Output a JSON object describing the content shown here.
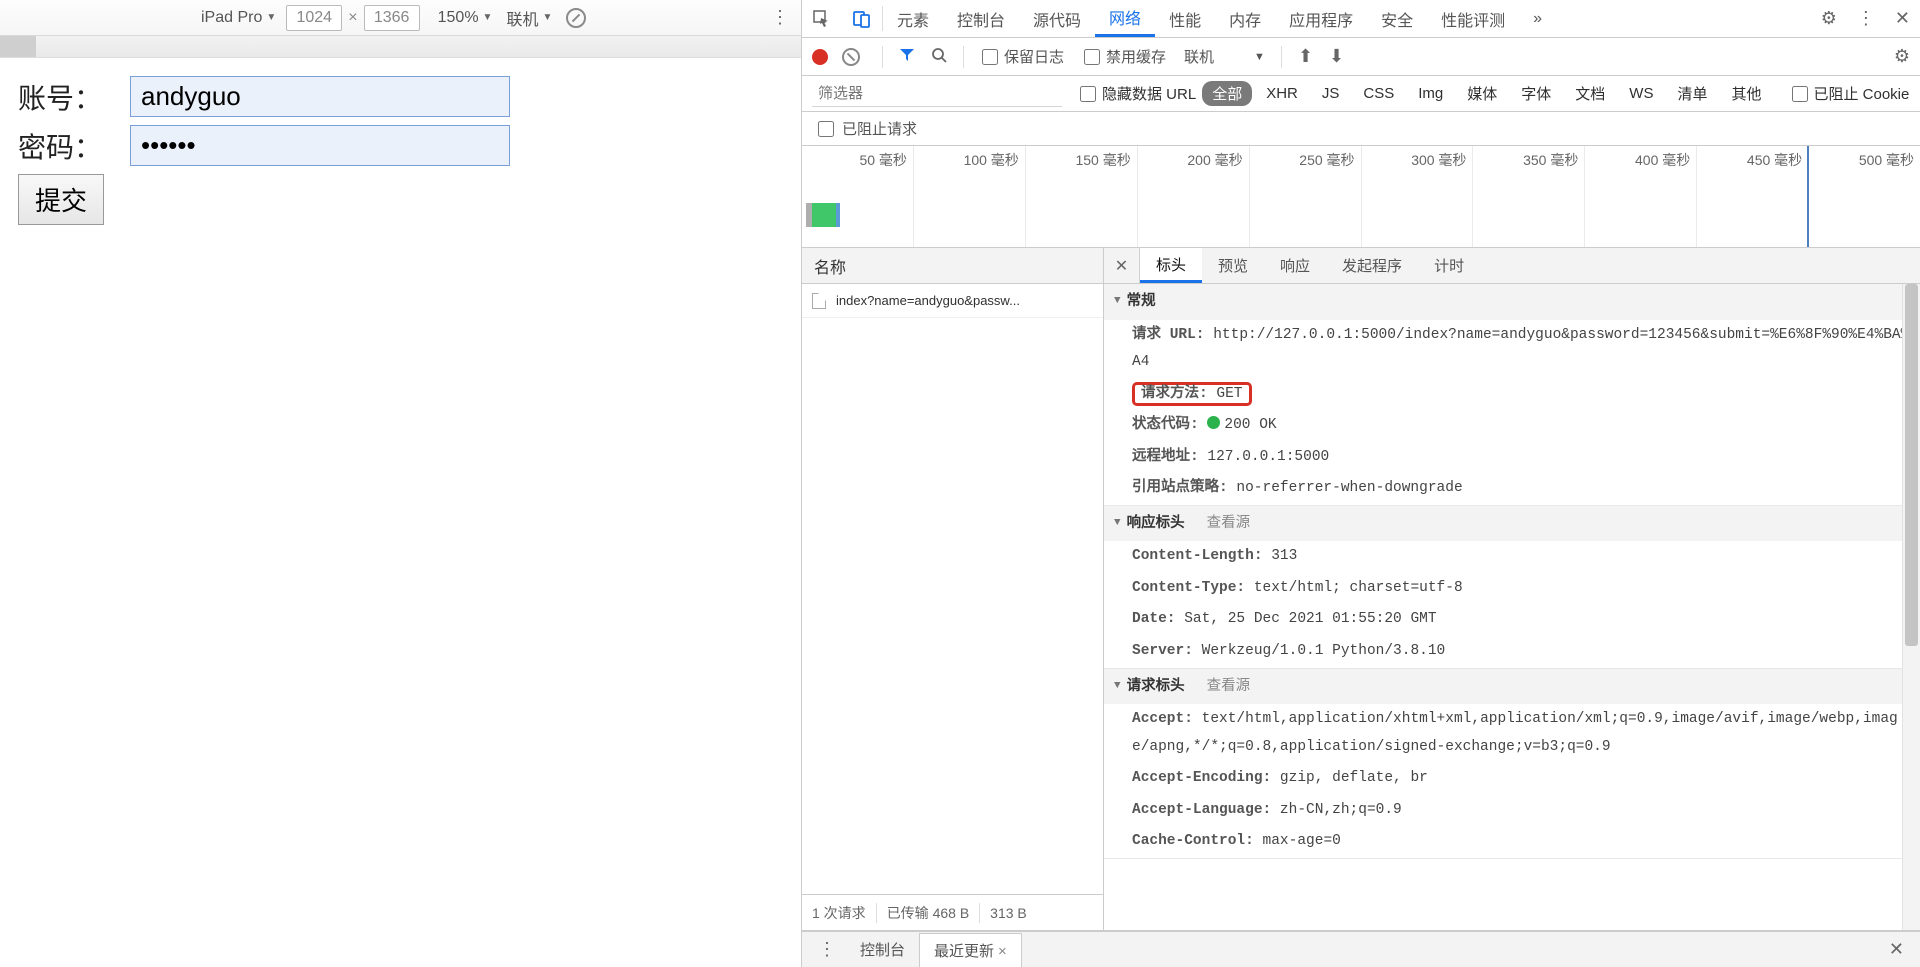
{
  "device_toolbar": {
    "device": "iPad Pro",
    "width": "1024",
    "height": "1366",
    "zoom": "150%",
    "status": "联机"
  },
  "form": {
    "account_label": "账号：",
    "password_label": "密码：",
    "account_value": "andyguo",
    "password_value": "••••••",
    "submit": "提交"
  },
  "devtools_tabs": [
    "元素",
    "控制台",
    "源代码",
    "网络",
    "性能",
    "内存",
    "应用程序",
    "安全",
    "性能评测"
  ],
  "devtools_active_tab": "网络",
  "network_toolbar": {
    "preserve_log": "保留日志",
    "disable_cache": "禁用缓存",
    "throttle": "联机"
  },
  "filter": {
    "placeholder": "筛选器",
    "hide_data_urls": "隐藏数据 URL",
    "chips": [
      "全部",
      "XHR",
      "JS",
      "CSS",
      "Img",
      "媒体",
      "字体",
      "文档",
      "WS",
      "清单",
      "其他"
    ],
    "active_chip": "全部",
    "blocked_cookies": "已阻止 Cookie"
  },
  "blocked_bar": {
    "label": "已阻止请求"
  },
  "timeline": {
    "labels": [
      "50 毫秒",
      "100 毫秒",
      "150 毫秒",
      "200 毫秒",
      "250 毫秒",
      "300 毫秒",
      "350 毫秒",
      "400 毫秒",
      "450 毫秒",
      "500 毫秒"
    ]
  },
  "names": {
    "header": "名称",
    "items": [
      "index?name=andyguo&passw..."
    ],
    "footer": {
      "requests": "1 次请求",
      "transferred": "已传输 468 B",
      "size": "313 B"
    }
  },
  "detail_tabs": [
    "标头",
    "预览",
    "响应",
    "发起程序",
    "计时"
  ],
  "detail_active": "标头",
  "general": {
    "title": "常规",
    "url_label": "请求 URL:",
    "url": "http://127.0.0.1:5000/index?name=andyguo&password=123456&submit=%E6%8F%90%E4%BA%A4",
    "method_label": "请求方法:",
    "method": "GET",
    "status_label": "状态代码:",
    "status": "200 OK",
    "remote_label": "远程地址:",
    "remote": "127.0.0.1:5000",
    "referrer_label": "引用站点策略:",
    "referrer": "no-referrer-when-downgrade"
  },
  "response_headers": {
    "title": "响应标头",
    "view_source": "查看源",
    "items": [
      {
        "k": "Content-Length:",
        "v": "313"
      },
      {
        "k": "Content-Type:",
        "v": "text/html; charset=utf-8"
      },
      {
        "k": "Date:",
        "v": "Sat, 25 Dec 2021 01:55:20 GMT"
      },
      {
        "k": "Server:",
        "v": "Werkzeug/1.0.1 Python/3.8.10"
      }
    ]
  },
  "request_headers": {
    "title": "请求标头",
    "view_source": "查看源",
    "items": [
      {
        "k": "Accept:",
        "v": "text/html,application/xhtml+xml,application/xml;q=0.9,image/avif,image/webp,image/apng,*/*;q=0.8,application/signed-exchange;v=b3;q=0.9"
      },
      {
        "k": "Accept-Encoding:",
        "v": "gzip, deflate, br"
      },
      {
        "k": "Accept-Language:",
        "v": "zh-CN,zh;q=0.9"
      },
      {
        "k": "Cache-Control:",
        "v": "max-age=0"
      }
    ]
  },
  "drawer": {
    "tabs": [
      "控制台",
      "最近更新"
    ],
    "active": "最近更新"
  }
}
